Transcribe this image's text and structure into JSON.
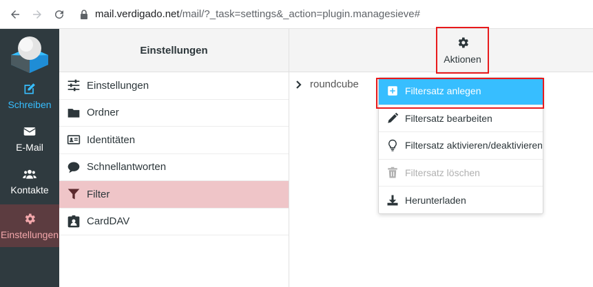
{
  "browser": {
    "url_domain": "mail.verdigado.net",
    "url_path": "/mail/?_task=settings&_action=plugin.managesieve#"
  },
  "nav": {
    "items": [
      {
        "label": "Schreiben"
      },
      {
        "label": "E-Mail"
      },
      {
        "label": "Kontakte"
      },
      {
        "label": "Einstellungen"
      }
    ]
  },
  "settings": {
    "header": "Einstellungen",
    "items": [
      {
        "label": "Einstellungen"
      },
      {
        "label": "Ordner"
      },
      {
        "label": "Identitäten"
      },
      {
        "label": "Schnellantworten"
      },
      {
        "label": "Filter"
      },
      {
        "label": "CardDAV"
      }
    ]
  },
  "right": {
    "actions_label": "Aktionen",
    "filterset_name": "roundcube"
  },
  "menu": {
    "items": [
      {
        "label": "Filtersatz anlegen"
      },
      {
        "label": "Filtersatz bearbeiten"
      },
      {
        "label": "Filtersatz aktivieren/deaktivieren"
      },
      {
        "label": "Filtersatz löschen"
      },
      {
        "label": "Herunterladen"
      }
    ]
  },
  "colors": {
    "accent": "#37beff",
    "highlight_frame": "#e8191b",
    "nav_bg": "#2f3a3f",
    "active_item_bg": "#efc5c8"
  }
}
